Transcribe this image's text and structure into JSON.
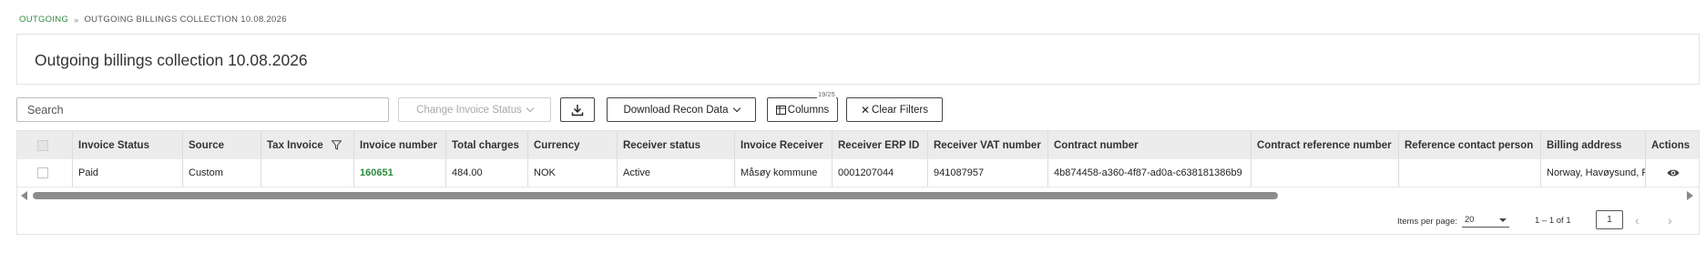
{
  "breadcrumb": {
    "root": "OUTGOING",
    "separator": "»",
    "current": "OUTGOING BILLINGS COLLECTION 10.08.2026"
  },
  "page": {
    "title": "Outgoing billings collection 10.08.2026"
  },
  "toolbar": {
    "search_placeholder": "Search",
    "change_status_label": "Change Invoice Status",
    "download_recon_label": "Download Recon Data",
    "columns_label": "Columns",
    "columns_badge": "19/25",
    "clear_filters_label": "Clear Filters"
  },
  "table": {
    "headers": [
      "Invoice Status",
      "Source",
      "Tax Invoice",
      "Invoice number",
      "Total charges",
      "Currency",
      "Receiver status",
      "Invoice Receiver",
      "Receiver ERP ID",
      "Receiver VAT number",
      "Contract number",
      "Contract reference number",
      "Reference contact person",
      "Billing address",
      "Actions"
    ],
    "rows": [
      {
        "invoice_status": "Paid",
        "source": "Custom",
        "tax_invoice": "",
        "invoice_number": "160651",
        "total_charges": "484.00",
        "currency": "NOK",
        "receiver_status": "Active",
        "invoice_receiver": "Måsøy kommune",
        "receiver_erp_id": "0001207044",
        "receiver_vat": "941087957",
        "contract_number": "4b874458-a360-4f87-ad0a-c638181386b9",
        "contract_reference": "",
        "reference_contact": "",
        "billing_address": "Norway, Havøysund, F"
      }
    ]
  },
  "paginator": {
    "items_per_page_label": "Items per page:",
    "items_per_page_value": "20",
    "range_label": "1 – 1 of 1",
    "current_page": "1"
  },
  "colors": {
    "accent": "#2e8b3e",
    "header_bg": "#ececec"
  }
}
